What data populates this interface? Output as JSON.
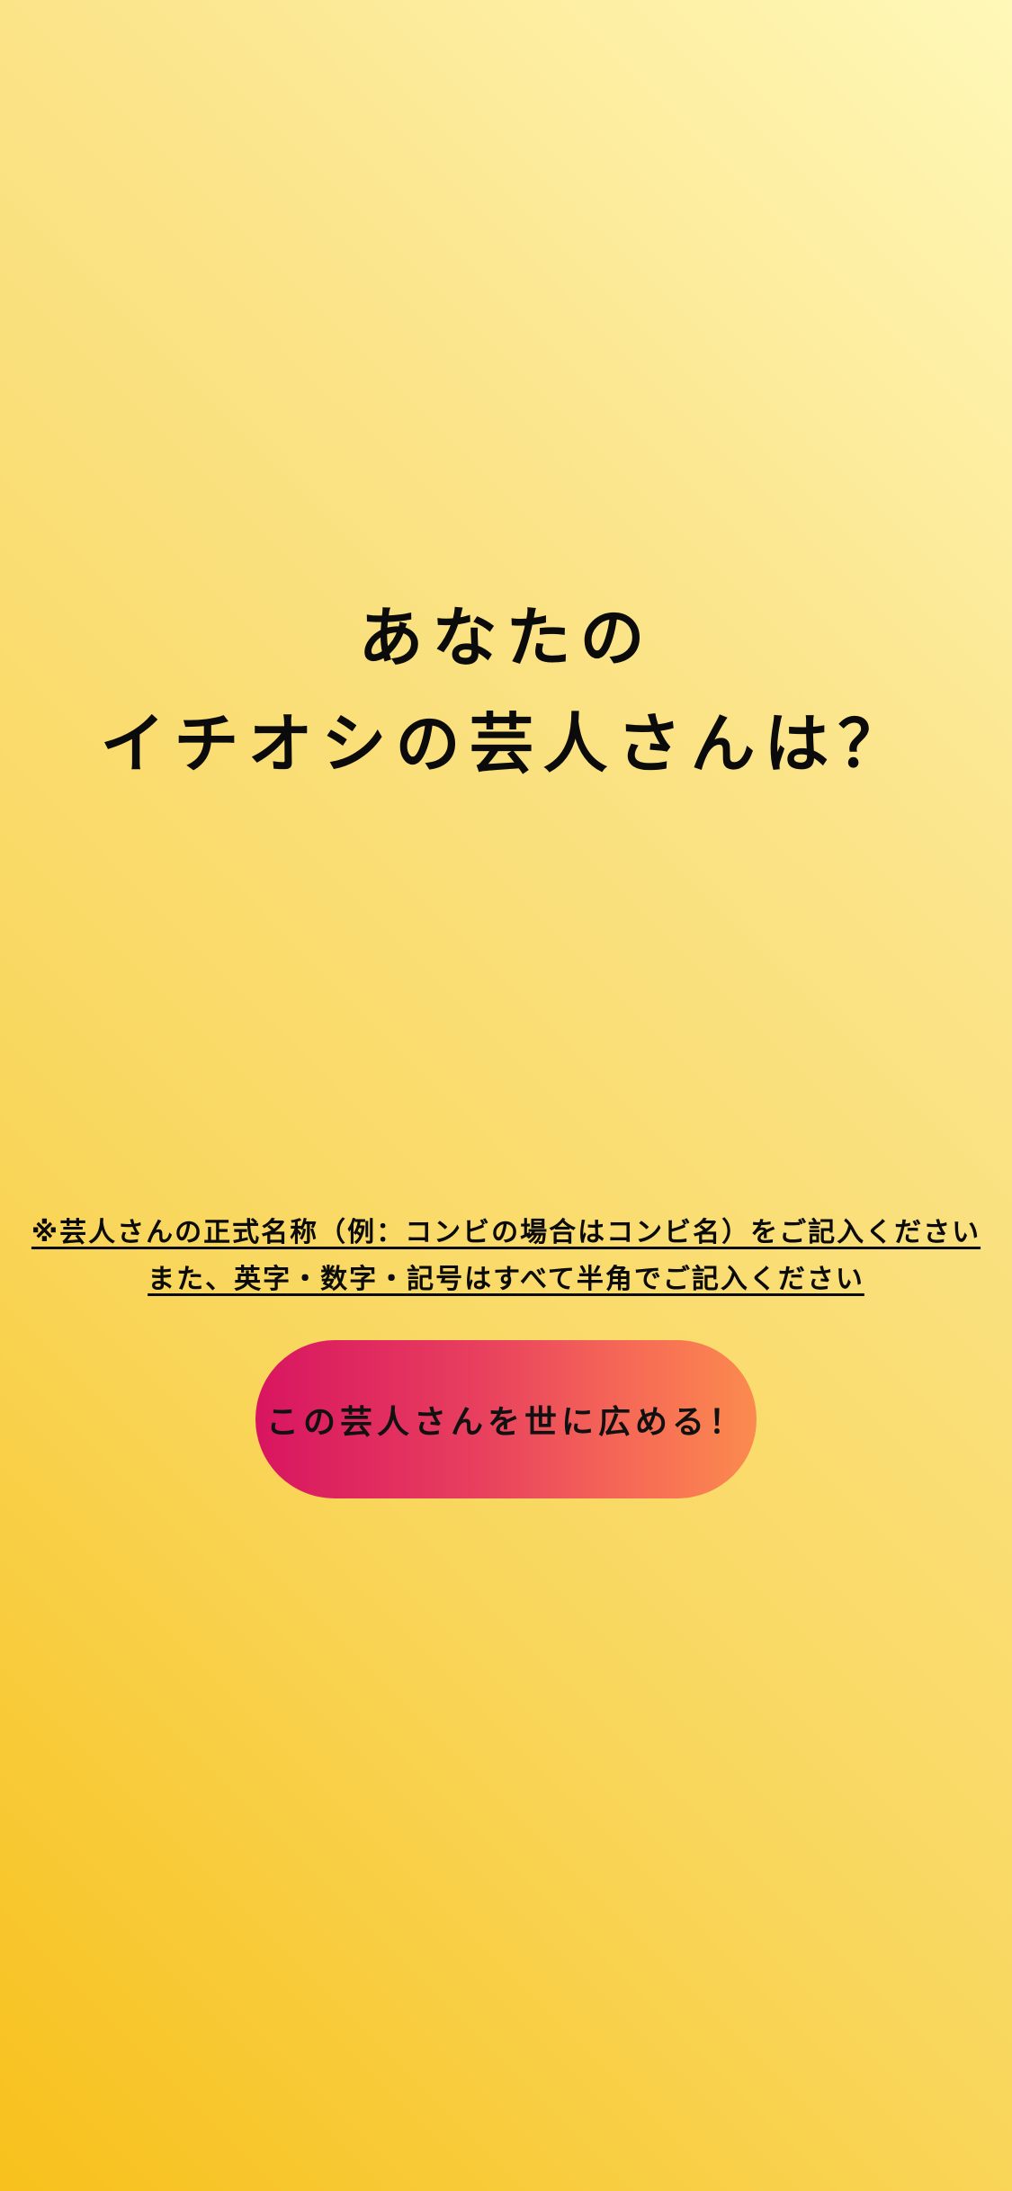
{
  "heading": {
    "line1": "あなたの",
    "line2": "イチオシの芸人さんは？"
  },
  "notice": {
    "line1": "※芸人さんの正式名称（例：コンビの場合はコンビ名）をご記入ください",
    "line2": "また、英字・数字・記号はすべて半角でご記入ください"
  },
  "cta": {
    "label": "この芸人さんを世に広める！"
  },
  "colors": {
    "background_top_right": "#fff8b8",
    "background_bottom_left": "#f8c11c",
    "button_gradient_start": "#d81560",
    "button_gradient_end": "#fb8b4e",
    "text": "#0b0b0b"
  }
}
